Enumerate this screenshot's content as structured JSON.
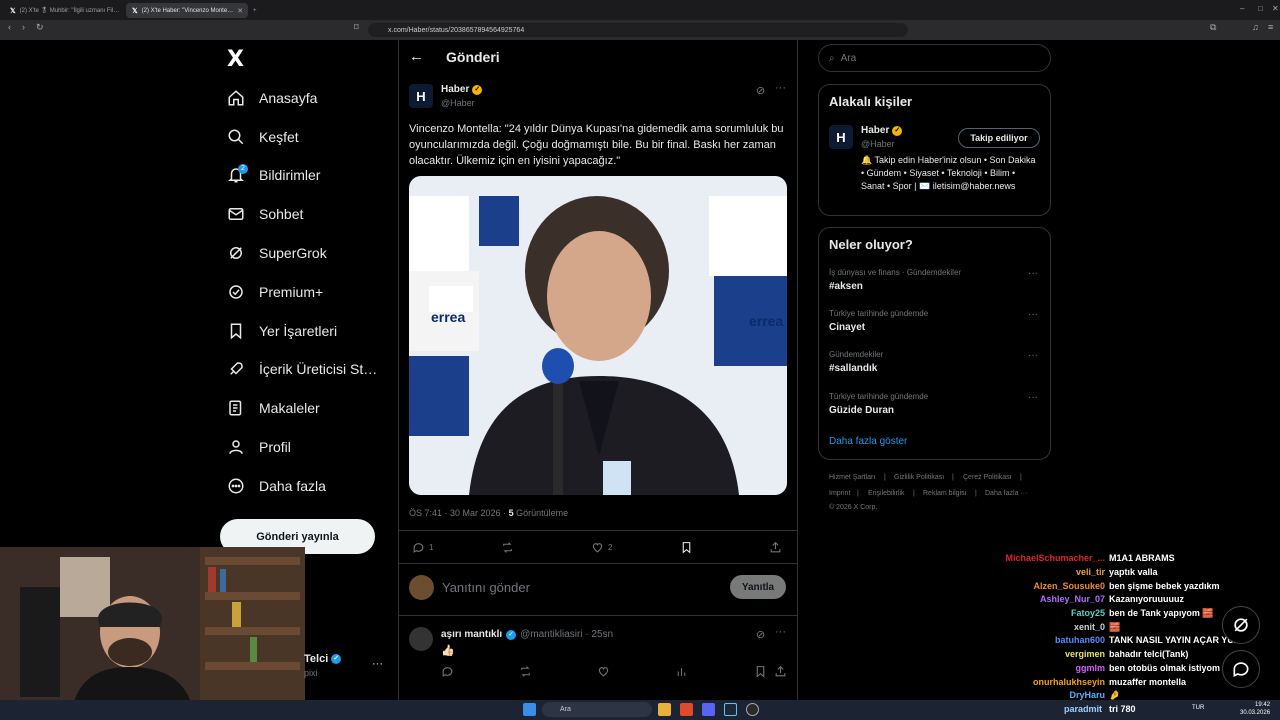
{
  "browser": {
    "tabs": [
      {
        "label": "(2) X'te 🎖 Muhbir: \"İlgili uzmanı Fil…"
      },
      {
        "label": "(2) X'te Haber: \"Vincenzo Monte…"
      }
    ],
    "url": "x.com/Haber/status/2038657894564925764"
  },
  "nav": {
    "logo": "X",
    "items": [
      {
        "label": "Anasayfa"
      },
      {
        "label": "Keşfet"
      },
      {
        "label": "Bildirimler"
      },
      {
        "label": "Sohbet"
      },
      {
        "label": "SuperGrok"
      },
      {
        "label": "Premium+"
      },
      {
        "label": "Yer İşaretleri"
      },
      {
        "label": "İçerik Üreticisi St…"
      },
      {
        "label": "Makaleler"
      },
      {
        "label": "Profil"
      },
      {
        "label": "Daha fazla"
      }
    ],
    "notif_count": "2",
    "post_button": "Gönderi yayınla",
    "profile_name": "Telci",
    "profile_handle": "pixi"
  },
  "main": {
    "title": "Gönderi",
    "tweet": {
      "avatar_letter": "H",
      "author": "Haber",
      "handle": "@Haber",
      "text": "Vincenzo Montella: \"24 yıldır Dünya Kupası'na gidemedik ama sorumluluk bu oyuncularımızda değil. Çoğu doğmamıştı bile. Bu bir final. Baskı her zaman olacaktır. Ülkemiz için en iyisini yapacağız.\"",
      "time": "ÖS 7:41 · 30 Mar 2026 · ",
      "views_count": "5",
      "views_label": " Görüntüleme",
      "replies": "1",
      "likes": "2"
    },
    "reply_placeholder": "Yanıtını gönder",
    "reply_button": "Yanıtla",
    "reply2": {
      "author": "aşırı mantıklı",
      "handle": "@mantikliasiri · 25sn",
      "text": "👍🏻"
    }
  },
  "right": {
    "search_placeholder": "Ara",
    "related_title": "Alakalı kişiler",
    "related": {
      "name": "Haber",
      "handle": "@Haber",
      "follow_label": "Takip ediliyor",
      "bio": "🔔 Takip edin Haber'iniz olsun • Son Dakika • Gündem • Siyaset • Teknoloji • Bilim • Sanat • Spor | ✉️ iletisim@haber.news"
    },
    "trends_title": "Neler oluyor?",
    "trends": [
      {
        "category": "İş dünyası ve finans · Gündemdekiler",
        "name": "#aksen"
      },
      {
        "category": "Türkiye tarihinde gündemde",
        "name": "Cinayet"
      },
      {
        "category": "Gündemdekiler",
        "name": "#sallandık"
      },
      {
        "category": "Türkiye tarihinde gündemde",
        "name": "Güzide Duran"
      }
    ],
    "show_more": "Daha fazla göster",
    "footer": [
      "Hizmet Şartları",
      "|",
      "Gizlilik Politikası",
      "|",
      "Çerez Politikası",
      "|",
      "Imprint",
      "|",
      "Erişilebilirlik",
      "|",
      "Reklam bilgisi",
      "|",
      "Daha fazla ···",
      "© 2026 X Corp."
    ]
  },
  "chat": [
    {
      "user": "MichaelSchumacher_...",
      "msg": "M1A1 ABRAMS",
      "color": "#e0242f"
    },
    {
      "user": "veli_tir",
      "msg": "yaptık valla",
      "color": "#e8a33a"
    },
    {
      "user": "Alzen_Sousuke0",
      "msg": "ben şişme bebek yazdıkm",
      "color": "#f08a2e"
    },
    {
      "user": "Ashley_Nur_07",
      "msg": "Kazanıyoruuuuuz",
      "color": "#b36bff"
    },
    {
      "user": "Fatoy25",
      "msg": "ben de Tank yapıyom 🧱",
      "color": "#5ad1c8"
    },
    {
      "user": "xenit_0",
      "msg": "🧱",
      "color": "#cfcfcf"
    },
    {
      "user": "batuhan600",
      "msg": "TANK NASIL YAYIN AÇAR YUA",
      "color": "#4f8cff"
    },
    {
      "user": "vergimen",
      "msg": "bahadır telci(Tank)",
      "color": "#e3e36a"
    },
    {
      "user": "ggmlm",
      "msg": "ben otobüs olmak istiyom",
      "color": "#d85cff"
    },
    {
      "user": "onurhalukhseyin",
      "msg": "muzaffer montella",
      "color": "#f0a020"
    },
    {
      "user": "DryHaru",
      "msg": "🤌",
      "color": "#4fb0ff"
    },
    {
      "user": "paradmit",
      "msg": "tri 780",
      "color": "#9fd0ff"
    }
  ],
  "taskbar": {
    "search": "Ara",
    "lang": "TUR",
    "time": "19:42",
    "date": "30.03.2026"
  }
}
